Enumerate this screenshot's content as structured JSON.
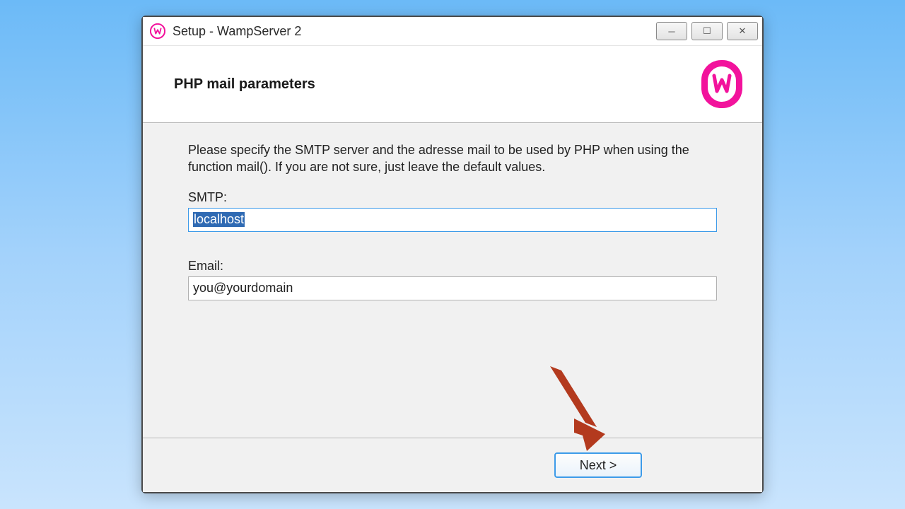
{
  "window": {
    "title": "Setup - WampServer 2"
  },
  "header": {
    "heading": "PHP mail parameters"
  },
  "body": {
    "instructions": "Please specify the SMTP server and the adresse mail to be used by PHP when using the function mail(). If you are not sure, just leave the default values.",
    "smtp_label": "SMTP:",
    "smtp_value": "localhost",
    "email_label": "Email:",
    "email_value": "you@yourdomain"
  },
  "footer": {
    "next_label": "Next >"
  },
  "icons": {
    "minimize": "─",
    "maximize": "☐",
    "close": "✕"
  },
  "colors": {
    "brand": "#f2139c",
    "selection": "#2f6ab3",
    "accent_border": "#3d9be9",
    "arrow": "#b33a1e"
  }
}
